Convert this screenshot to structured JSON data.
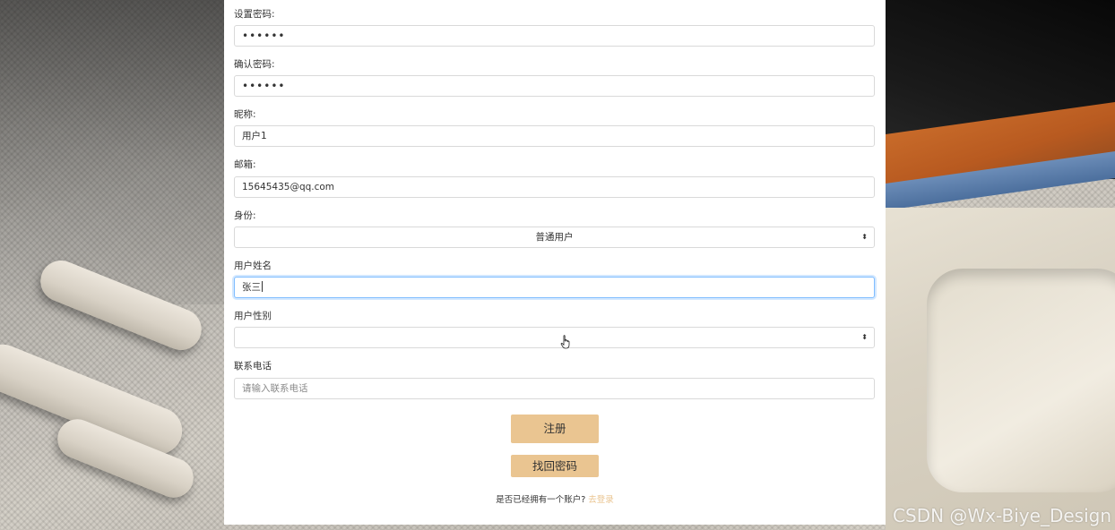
{
  "form": {
    "set_password": {
      "label": "设置密码:",
      "value": "••••••"
    },
    "confirm_password": {
      "label": "确认密码:",
      "value": "••••••"
    },
    "nickname": {
      "label": "昵称:",
      "value": "用户1"
    },
    "email": {
      "label": "邮箱:",
      "value": "15645435@qq.com"
    },
    "identity": {
      "label": "身份:",
      "selected": "普通用户",
      "arrow": "⬍"
    },
    "real_name": {
      "label": "用户姓名",
      "value": "张三"
    },
    "gender": {
      "label": "用户性别",
      "selected": "",
      "arrow": "⬍"
    },
    "phone": {
      "label": "联系电话",
      "placeholder": "请输入联系电话"
    }
  },
  "buttons": {
    "register": "注册",
    "recover_password": "找回密码"
  },
  "login_prompt": {
    "text": "是否已经拥有一个账户?",
    "link": "去登录"
  },
  "watermark": "CSDN @Wx-Biye_Design",
  "colors": {
    "button_bg": "#eac591",
    "link": "#eac591",
    "focus_border": "#80bdff"
  }
}
